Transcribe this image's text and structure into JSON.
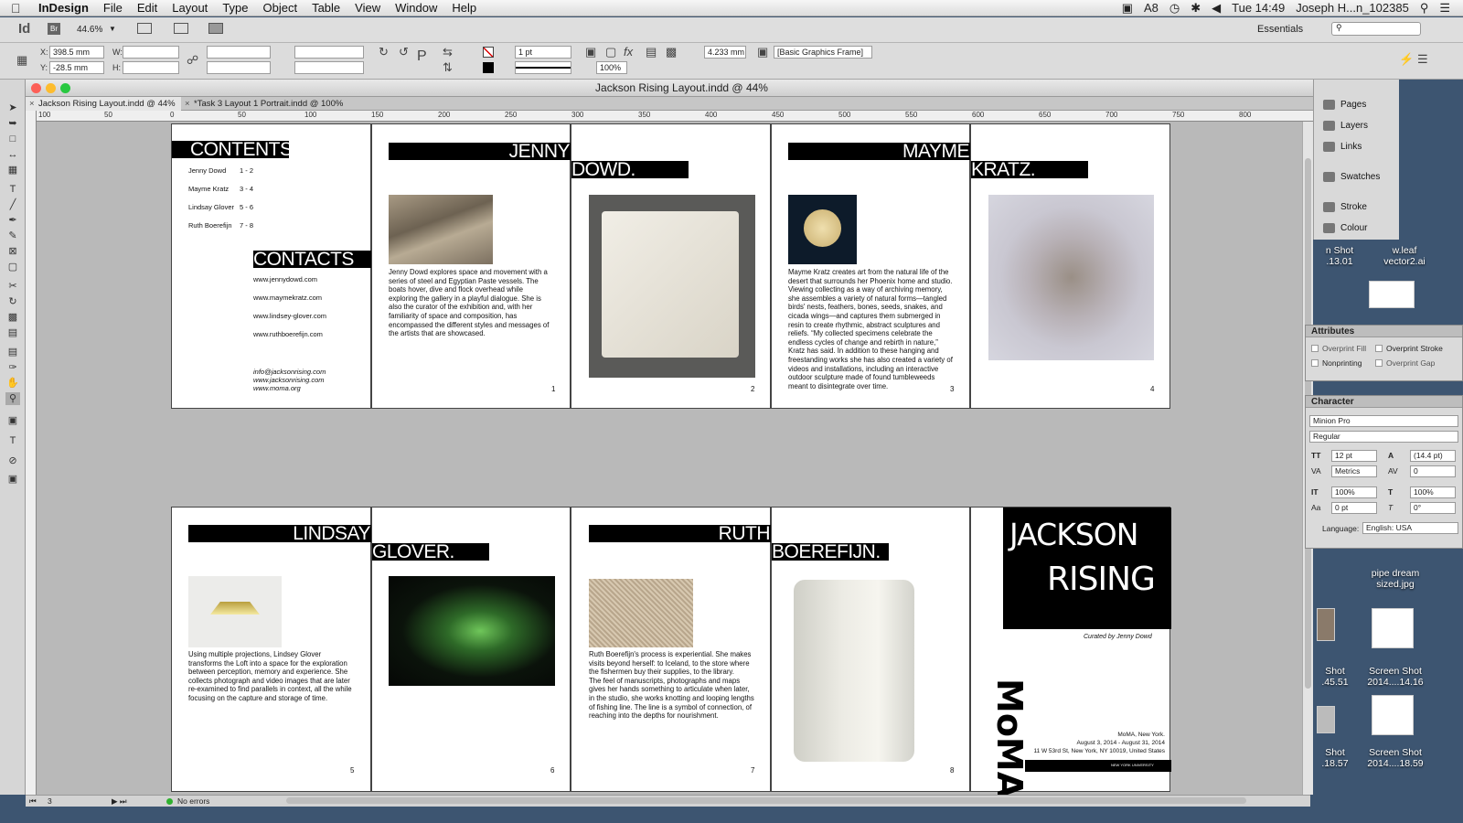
{
  "menubar": {
    "app": "InDesign",
    "items": [
      "File",
      "Edit",
      "Layout",
      "Type",
      "Object",
      "Table",
      "View",
      "Window",
      "Help"
    ],
    "clock": "Tue 14:49",
    "user": "Joseph H...n_102385",
    "badge": "8"
  },
  "appbar": {
    "zoom": "44.6%",
    "workspace": "Essentials"
  },
  "control": {
    "x": "398.5 mm",
    "y": "-28.5 mm",
    "w_label": "W:",
    "h_label": "H:",
    "x_label": "X:",
    "y_label": "Y:",
    "stroke_weight": "1 pt",
    "scale": "100%",
    "dim": "4.233 mm",
    "object_style": "[Basic Graphics Frame]"
  },
  "window": {
    "title": "Jackson Rising Layout.indd @ 44%",
    "tabs": [
      "Jackson Rising Layout.indd @ 44%",
      "*Task 3 Layout 1 Portrait.indd @ 100%"
    ]
  },
  "ruler": [
    "100",
    "50",
    "0",
    "50",
    "100",
    "150",
    "200",
    "250",
    "300",
    "350",
    "400",
    "450",
    "500",
    "550",
    "600",
    "650",
    "700",
    "750",
    "800"
  ],
  "spread1": {
    "contents_title": "CONTENTS",
    "contents": [
      {
        "name": "Jenny Dowd",
        "pages": "1 - 2"
      },
      {
        "name": "Mayme Kratz",
        "pages": "3 - 4"
      },
      {
        "name": "Lindsay Glover",
        "pages": "5 - 6"
      },
      {
        "name": "Ruth Boerefijn",
        "pages": "7 - 8"
      }
    ],
    "contacts_title": "CONTACTS",
    "contacts": [
      "www.jennydowd.com",
      "www.maymekratz.com",
      "www.lindsey-glover.com",
      "www.ruthboerefijn.com"
    ],
    "footer_lines": [
      "info@jacksonrising.com",
      "www.jacksonrising.com",
      "www.moma.org"
    ],
    "jenny_first": "JENNY",
    "jenny_last": "DOWD.",
    "jenny_text": "Jenny Dowd explores space and movement with a series of steel and Egyptian Paste vessels. The boats hover, dive and flock overhead while exploring the gallery in a playful dialogue. She is also the curator of the exhibition and, with her familiarity of space and composition, has encompassed the different styles and messages of the artists that are showcased.",
    "mayme_first": "MAYME",
    "mayme_last": "KRATZ.",
    "mayme_text": "Mayme Kratz creates art from the natural life of the desert that surrounds her Phoenix home and studio. Viewing collecting as a way of archiving memory, she assembles a variety of natural forms—tangled birds' nests, feathers, bones, seeds, snakes, and cicada wings—and captures them submerged in resin to create rhythmic, abstract sculptures and reliefs. “My collected specimens celebrate the endless cycles of change and rebirth in nature,” Kratz has said. In addition to these hanging and freestanding works she has also created a variety of videos and installations, including an interactive outdoor sculpture made of found tumbleweeds meant to disintegrate over time.",
    "page_numbers": [
      "1",
      "2",
      "3",
      "4"
    ]
  },
  "spread2": {
    "lindsay_first": "LINDSAY",
    "lindsay_last": "GLOVER.",
    "lindsay_text": "Using multiple projections, Lindsey Glover transforms the Loft into a space for the exploration between perception, memory and experience. She collects photograph and video images that are later re-examined to find parallels in context, all the while focusing on the capture and storage of time.",
    "ruth_first": "RUTH",
    "ruth_last": "BOEREFIJN.",
    "ruth_text": "Ruth Boerefijn's process is experiential. She makes visits beyond herself: to Iceland, to the store where the fishermen buy their supplies, to the library.\nThe feel of manuscripts, photographs and maps gives her hands something to articulate when later, in the studio, she works knotting and looping lengths of fishing line. The line is a symbol of connection, of reaching into the depths for nourishment.",
    "cover_title_1": "JACKSON",
    "cover_title_2": "RISING",
    "curated": "Curated by Jenny Dowd",
    "moma": "MoMA",
    "cover_info": [
      "MoMA, New York.",
      "August 3, 2014 - August 31, 2014",
      "11 W 53rd St, New York, NY 10019, United States"
    ],
    "footer_logo": "NEW YORK UNIVERSITY",
    "page_numbers": [
      "5",
      "6",
      "7",
      "8"
    ]
  },
  "dock": [
    "Pages",
    "Layers",
    "Links",
    "Swatches",
    "Stroke",
    "Colour"
  ],
  "attributes": {
    "title": "Attributes",
    "options": [
      "Overprint Fill",
      "Overprint Stroke",
      "Nonprinting",
      "Overprint Gap"
    ]
  },
  "character": {
    "title": "Character",
    "font": "Minion Pro",
    "style": "Regular",
    "size": "12 pt",
    "leading": "(14.4 pt)",
    "kerning": "Metrics",
    "tracking": "0",
    "vscale": "100%",
    "hscale": "100%",
    "baseline": "0 pt",
    "skew": "0°",
    "language_label": "Language:",
    "language": "English: USA"
  },
  "desktop": {
    "icons": [
      "n Shot\n.13.01",
      "w.leaf\nvector2.ai",
      "pipe dream\nsized.jpg",
      "Shot\n.45.51",
      "Screen Shot\n2014....14.16",
      "Shot\n.18.57",
      "Screen Shot\n2014....18.59"
    ]
  },
  "status": {
    "page": "3",
    "errors": "No errors"
  }
}
